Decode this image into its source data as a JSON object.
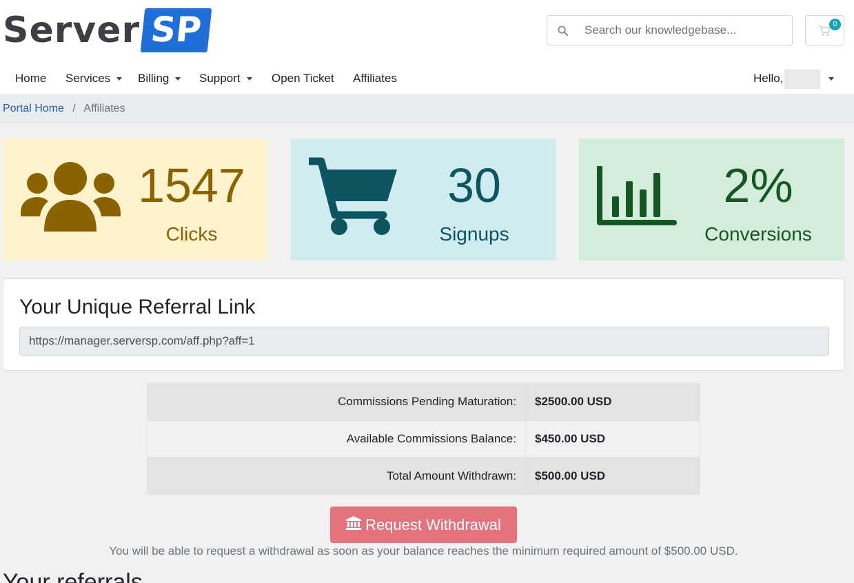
{
  "brand": {
    "logo_text_1": "Server",
    "logo_text_2": "SP"
  },
  "search": {
    "placeholder": "Search our knowledgebase..."
  },
  "cart": {
    "count": "0"
  },
  "nav": {
    "home": "Home",
    "services": "Services",
    "billing": "Billing",
    "support": "Support",
    "open_ticket": "Open Ticket",
    "affiliates": "Affiliates",
    "hello": "Hello,"
  },
  "breadcrumb": {
    "home": "Portal Home",
    "separator": "/",
    "current": "Affiliates"
  },
  "stats": {
    "clicks": {
      "value": "1547",
      "label": "Clicks",
      "icon": "users-icon",
      "color": "#8a6300",
      "bg": "#fff3cd"
    },
    "signups": {
      "value": "30",
      "label": "Signups",
      "icon": "shopping-cart-icon",
      "color": "#0c5460",
      "bg": "#d1ecf1"
    },
    "conversions": {
      "value": "2%",
      "label": "Conversions",
      "icon": "bar-chart-icon",
      "color": "#155724",
      "bg": "#d4edda"
    }
  },
  "referral": {
    "title": "Your Unique Referral Link",
    "link": "https://manager.serversp.com/aff.php?aff=1"
  },
  "commissions": [
    {
      "label": "Commissions Pending Maturation:",
      "value": "$2500.00 USD"
    },
    {
      "label": "Available Commissions Balance:",
      "value": "$450.00 USD"
    },
    {
      "label": "Total Amount Withdrawn:",
      "value": "$500.00 USD"
    }
  ],
  "withdraw": {
    "button_label": "Request Withdrawal",
    "note": "You will be able to request a withdrawal as soon as your balance reaches the minimum required amount of $500.00 USD."
  },
  "next_section": {
    "heading": "Your referrals"
  },
  "colors": {
    "accent": "#1f6fd6",
    "link": "#2a5ea8",
    "withdraw_button": "#e4737e"
  }
}
